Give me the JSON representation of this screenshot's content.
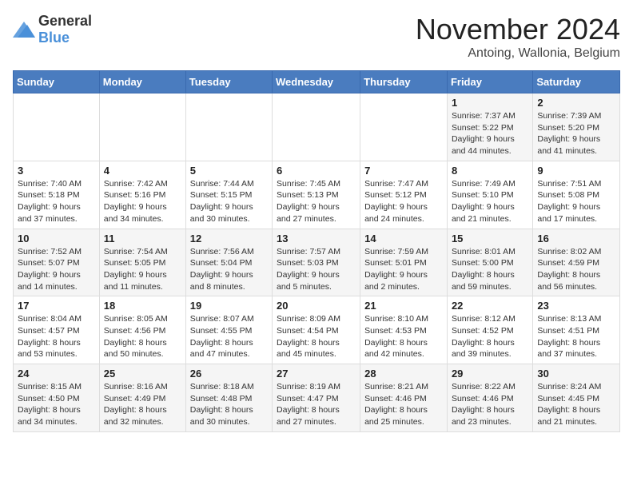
{
  "header": {
    "logo_general": "General",
    "logo_blue": "Blue",
    "month": "November 2024",
    "location": "Antoing, Wallonia, Belgium"
  },
  "weekdays": [
    "Sunday",
    "Monday",
    "Tuesday",
    "Wednesday",
    "Thursday",
    "Friday",
    "Saturday"
  ],
  "weeks": [
    [
      {
        "day": "",
        "info": ""
      },
      {
        "day": "",
        "info": ""
      },
      {
        "day": "",
        "info": ""
      },
      {
        "day": "",
        "info": ""
      },
      {
        "day": "",
        "info": ""
      },
      {
        "day": "1",
        "info": "Sunrise: 7:37 AM\nSunset: 5:22 PM\nDaylight: 9 hours and 44 minutes."
      },
      {
        "day": "2",
        "info": "Sunrise: 7:39 AM\nSunset: 5:20 PM\nDaylight: 9 hours and 41 minutes."
      }
    ],
    [
      {
        "day": "3",
        "info": "Sunrise: 7:40 AM\nSunset: 5:18 PM\nDaylight: 9 hours and 37 minutes."
      },
      {
        "day": "4",
        "info": "Sunrise: 7:42 AM\nSunset: 5:16 PM\nDaylight: 9 hours and 34 minutes."
      },
      {
        "day": "5",
        "info": "Sunrise: 7:44 AM\nSunset: 5:15 PM\nDaylight: 9 hours and 30 minutes."
      },
      {
        "day": "6",
        "info": "Sunrise: 7:45 AM\nSunset: 5:13 PM\nDaylight: 9 hours and 27 minutes."
      },
      {
        "day": "7",
        "info": "Sunrise: 7:47 AM\nSunset: 5:12 PM\nDaylight: 9 hours and 24 minutes."
      },
      {
        "day": "8",
        "info": "Sunrise: 7:49 AM\nSunset: 5:10 PM\nDaylight: 9 hours and 21 minutes."
      },
      {
        "day": "9",
        "info": "Sunrise: 7:51 AM\nSunset: 5:08 PM\nDaylight: 9 hours and 17 minutes."
      }
    ],
    [
      {
        "day": "10",
        "info": "Sunrise: 7:52 AM\nSunset: 5:07 PM\nDaylight: 9 hours and 14 minutes."
      },
      {
        "day": "11",
        "info": "Sunrise: 7:54 AM\nSunset: 5:05 PM\nDaylight: 9 hours and 11 minutes."
      },
      {
        "day": "12",
        "info": "Sunrise: 7:56 AM\nSunset: 5:04 PM\nDaylight: 9 hours and 8 minutes."
      },
      {
        "day": "13",
        "info": "Sunrise: 7:57 AM\nSunset: 5:03 PM\nDaylight: 9 hours and 5 minutes."
      },
      {
        "day": "14",
        "info": "Sunrise: 7:59 AM\nSunset: 5:01 PM\nDaylight: 9 hours and 2 minutes."
      },
      {
        "day": "15",
        "info": "Sunrise: 8:01 AM\nSunset: 5:00 PM\nDaylight: 8 hours and 59 minutes."
      },
      {
        "day": "16",
        "info": "Sunrise: 8:02 AM\nSunset: 4:59 PM\nDaylight: 8 hours and 56 minutes."
      }
    ],
    [
      {
        "day": "17",
        "info": "Sunrise: 8:04 AM\nSunset: 4:57 PM\nDaylight: 8 hours and 53 minutes."
      },
      {
        "day": "18",
        "info": "Sunrise: 8:05 AM\nSunset: 4:56 PM\nDaylight: 8 hours and 50 minutes."
      },
      {
        "day": "19",
        "info": "Sunrise: 8:07 AM\nSunset: 4:55 PM\nDaylight: 8 hours and 47 minutes."
      },
      {
        "day": "20",
        "info": "Sunrise: 8:09 AM\nSunset: 4:54 PM\nDaylight: 8 hours and 45 minutes."
      },
      {
        "day": "21",
        "info": "Sunrise: 8:10 AM\nSunset: 4:53 PM\nDaylight: 8 hours and 42 minutes."
      },
      {
        "day": "22",
        "info": "Sunrise: 8:12 AM\nSunset: 4:52 PM\nDaylight: 8 hours and 39 minutes."
      },
      {
        "day": "23",
        "info": "Sunrise: 8:13 AM\nSunset: 4:51 PM\nDaylight: 8 hours and 37 minutes."
      }
    ],
    [
      {
        "day": "24",
        "info": "Sunrise: 8:15 AM\nSunset: 4:50 PM\nDaylight: 8 hours and 34 minutes."
      },
      {
        "day": "25",
        "info": "Sunrise: 8:16 AM\nSunset: 4:49 PM\nDaylight: 8 hours and 32 minutes."
      },
      {
        "day": "26",
        "info": "Sunrise: 8:18 AM\nSunset: 4:48 PM\nDaylight: 8 hours and 30 minutes."
      },
      {
        "day": "27",
        "info": "Sunrise: 8:19 AM\nSunset: 4:47 PM\nDaylight: 8 hours and 27 minutes."
      },
      {
        "day": "28",
        "info": "Sunrise: 8:21 AM\nSunset: 4:46 PM\nDaylight: 8 hours and 25 minutes."
      },
      {
        "day": "29",
        "info": "Sunrise: 8:22 AM\nSunset: 4:46 PM\nDaylight: 8 hours and 23 minutes."
      },
      {
        "day": "30",
        "info": "Sunrise: 8:24 AM\nSunset: 4:45 PM\nDaylight: 8 hours and 21 minutes."
      }
    ]
  ]
}
